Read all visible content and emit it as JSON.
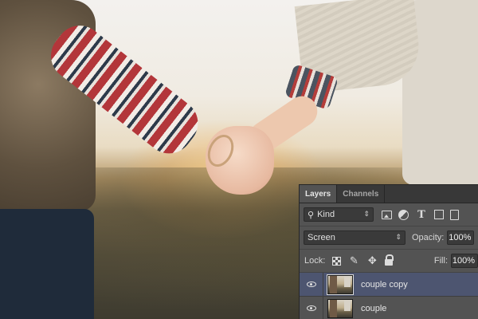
{
  "panel": {
    "tabs": [
      {
        "label": "Layers",
        "active": true
      },
      {
        "label": "Channels",
        "active": false
      }
    ],
    "filter": {
      "kind_label": "Kind",
      "icons": [
        "image-filter-icon",
        "adjustment-filter-icon",
        "type-filter-icon",
        "shape-filter-icon",
        "smart-object-filter-icon"
      ],
      "type_glyph": "T"
    },
    "blend_mode": "Screen",
    "opacity_label": "Opacity:",
    "opacity_value": "100%",
    "lock_label": "Lock:",
    "lock_icons": [
      "lock-transparent-pixels-icon",
      "lock-image-pixels-icon",
      "lock-position-icon",
      "lock-all-icon"
    ],
    "fill_label": "Fill:",
    "fill_value": "100%",
    "layers": [
      {
        "name": "couple copy",
        "visible": true,
        "selected": true
      },
      {
        "name": "couple",
        "visible": true,
        "selected": false
      }
    ]
  },
  "colors": {
    "panel_bg": "#535353",
    "tab_bar_bg": "#383838",
    "selected_layer_bg": "#4d5570"
  }
}
